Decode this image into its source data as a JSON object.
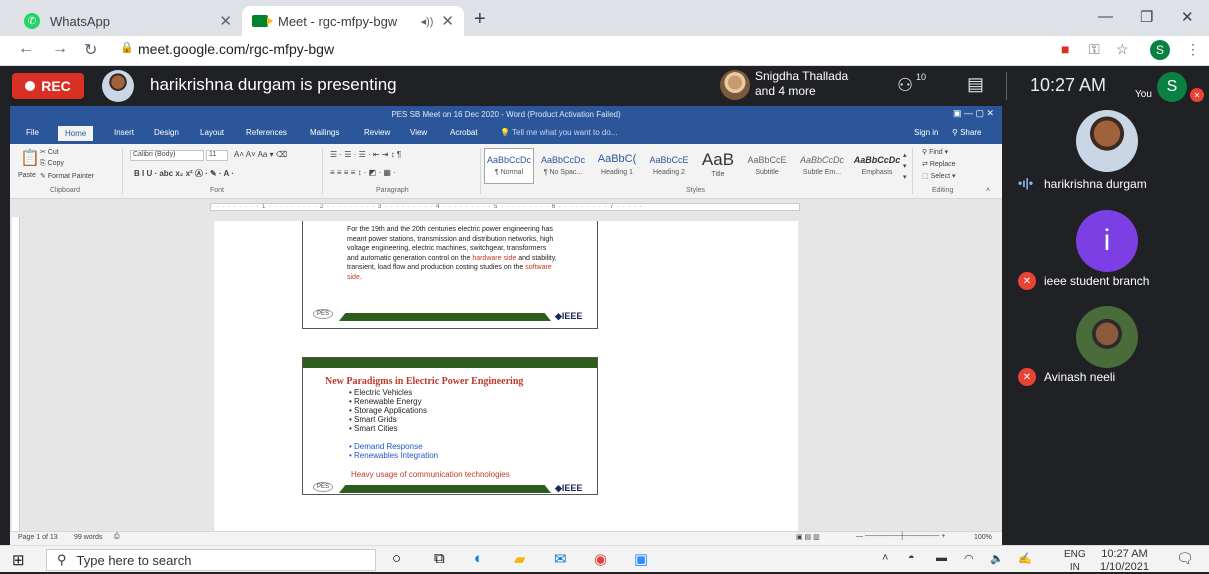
{
  "browser": {
    "tabs": [
      {
        "title": "WhatsApp"
      },
      {
        "title": "Meet - rgc-mfpy-bgw"
      }
    ],
    "url": "meet.google.com/rgc-mfpy-bgw",
    "profile_initial": "S"
  },
  "meet": {
    "rec_label": "REC",
    "presenting_text": "harikrishna durgam is presenting",
    "participants_line1": "Snigdha Thallada",
    "participants_line2": "and 4 more",
    "people_count": "10",
    "time": "10:27 AM",
    "you_label": "You",
    "you_initial": "S"
  },
  "word": {
    "title": "PES SB Meet on 16 Dec 2020 - Word (Product Activation Failed)",
    "tabs": [
      "File",
      "Home",
      "Insert",
      "Design",
      "Layout",
      "References",
      "Mailings",
      "Review",
      "View",
      "Acrobat"
    ],
    "tell_me": "Tell me what you want to do...",
    "sign_in": "Sign in",
    "share": "Share",
    "clipboard": {
      "cut": "Cut",
      "copy": "Copy",
      "paste": "Paste",
      "format_painter": "Format Painter",
      "group": "Clipboard"
    },
    "font": {
      "name": "Calibri (Body)",
      "size": "11",
      "group": "Font"
    },
    "paragraph_group": "Paragraph",
    "styles": [
      {
        "sample": "AaBbCcDc",
        "name": "¶ Normal"
      },
      {
        "sample": "AaBbCcDc",
        "name": "¶ No Spac..."
      },
      {
        "sample": "AaBbC(",
        "name": "Heading 1"
      },
      {
        "sample": "AaBbCcE",
        "name": "Heading 2"
      },
      {
        "sample": "AaB",
        "name": "Title"
      },
      {
        "sample": "AaBbCcE",
        "name": "Subtitle"
      },
      {
        "sample": "AaBbCcDc",
        "name": "Subtle Em..."
      },
      {
        "sample": "AaBbCcDc",
        "name": "Emphasis"
      }
    ],
    "styles_group": "Styles",
    "editing": {
      "find": "Find",
      "replace": "Replace",
      "select": "Select",
      "group": "Editing"
    },
    "slide1": {
      "text_a": "For the 19th and the 20th centuries electric power engineering has meant power stations, transmission and distribution networks, high voltage engineering, electric machines, switchgear, transformers and automatic generation control on the ",
      "text_red1": "hardware side",
      "text_b": " and stability, transient, load flow and production costing studies on the ",
      "text_red2": "software side",
      "text_c": ".",
      "ieee": "IEEE",
      "logo": "PES"
    },
    "slide2": {
      "title": "New Paradigms in Electric Power Engineering",
      "bullets": [
        "Electric Vehicles",
        "Renewable Energy",
        "Storage Applications",
        "Smart Grids",
        "Smart Cities"
      ],
      "blue_bullets": [
        "Demand Response",
        "Renewables Integration"
      ],
      "footer_red": "Heavy usage of communication technologies",
      "ieee": "IEEE",
      "logo": "PES"
    },
    "status": {
      "page": "Page 1 of 13",
      "words": "99 words",
      "zoom": "100%"
    }
  },
  "participants": [
    {
      "name": "harikrishna durgam",
      "speaking": true
    },
    {
      "name": "ieee student branch",
      "initial": "i",
      "muted": true
    },
    {
      "name": "Avinash neeli",
      "muted": true
    }
  ],
  "taskbar": {
    "search_placeholder": "Type here to search",
    "lang1": "ENG",
    "lang2": "IN",
    "time": "10:27 AM",
    "date": "1/10/2021"
  }
}
